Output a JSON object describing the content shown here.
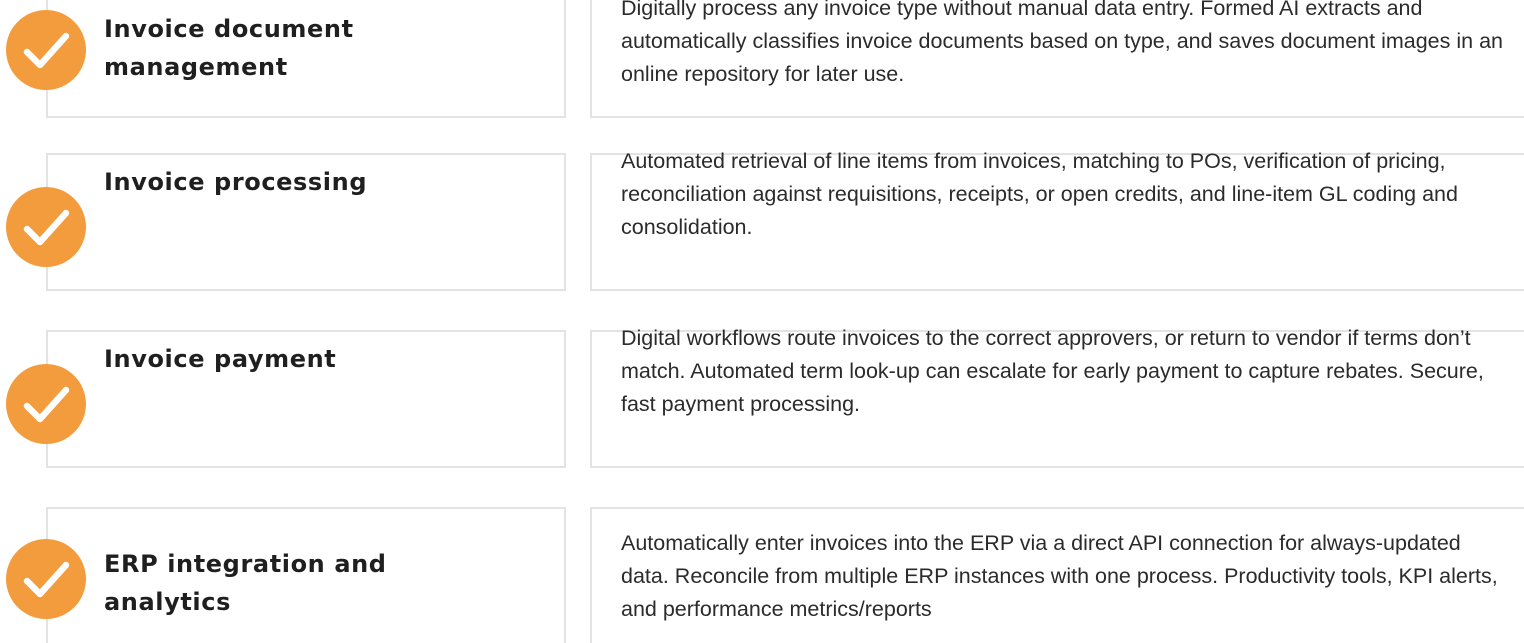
{
  "features": [
    {
      "title": "Invoice document management",
      "description": "Digitally process any invoice type without manual data entry. Formed AI extracts and automatically classifies invoice documents based on type, and saves document images in an online repository for later use.",
      "icon": "checkmark-icon"
    },
    {
      "title": "Invoice processing",
      "description": "Automated retrieval of line items from invoices, matching to POs, verification of pricing, reconciliation against requisitions, receipts, or open credits, and line-item GL coding and consolidation.",
      "icon": "checkmark-icon"
    },
    {
      "title": "Invoice payment",
      "description": "Digital workflows route invoices to the correct approvers, or return to vendor if terms don’t match. Automated term look-up can escalate for early payment to capture rebates. Secure, fast payment processing.",
      "icon": "checkmark-icon"
    },
    {
      "title": "ERP integration and analytics",
      "description": "Automatically enter invoices into the ERP via a direct API connection for always-updated data. Reconcile from multiple ERP instances with one process. Productivity tools, KPI alerts, and performance metrics/reports",
      "icon": "checkmark-icon"
    }
  ],
  "colors": {
    "accent": "#f39c3d",
    "border": "#e3e3e3",
    "title_text": "#1f1f1f",
    "body_text": "#2b2b2b"
  }
}
